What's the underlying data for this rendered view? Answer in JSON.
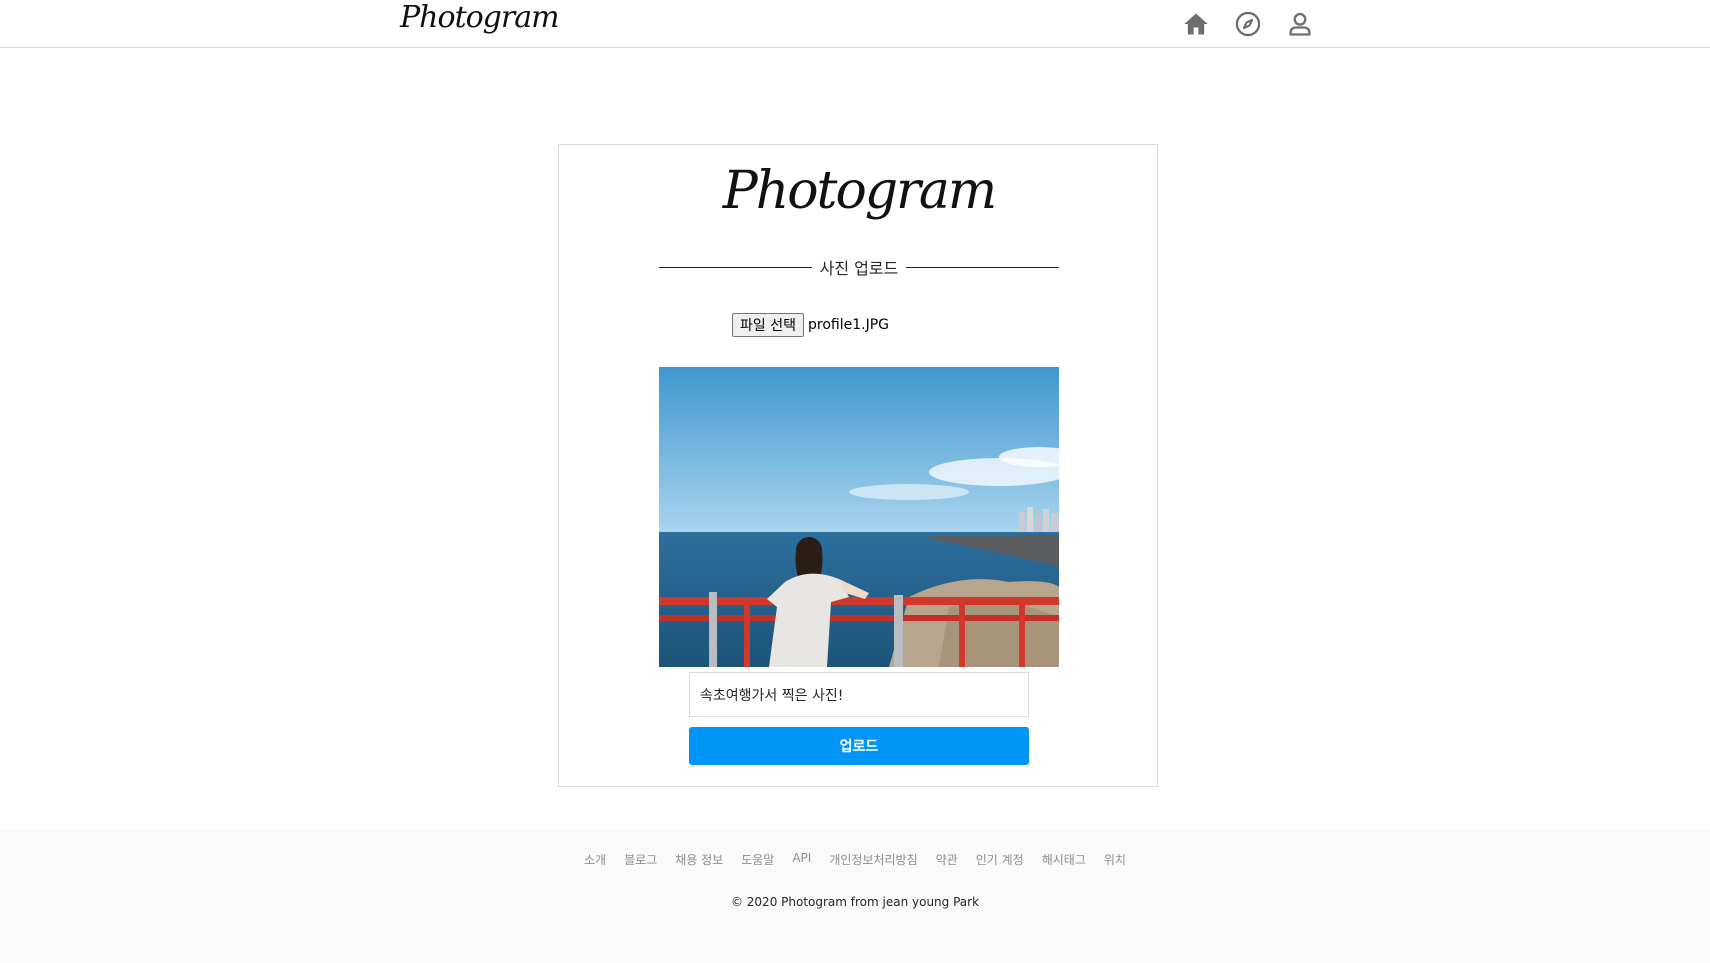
{
  "header": {
    "logo": "Photogram",
    "nav": {
      "home_icon": "home-icon",
      "explore_icon": "compass-icon",
      "profile_icon": "user-icon"
    }
  },
  "upload_form": {
    "logo": "Photogram",
    "section_title": "사진 업로드",
    "file_button_label": "파일 선택",
    "file_name": "profile1.JPG",
    "caption_value": "속초여행가서 찍은 사진!",
    "submit_label": "업로드"
  },
  "footer": {
    "links": [
      "소개",
      "블로그",
      "채용 정보",
      "도움말",
      "API",
      "개인정보처리방침",
      "약관",
      "인기 계정",
      "해시태그",
      "위치"
    ],
    "copyright": "© 2020 Photogram from jean young Park"
  },
  "colors": {
    "accent": "#0095f6",
    "border": "#dbdbdb",
    "footer_bg": "#fafafa"
  }
}
